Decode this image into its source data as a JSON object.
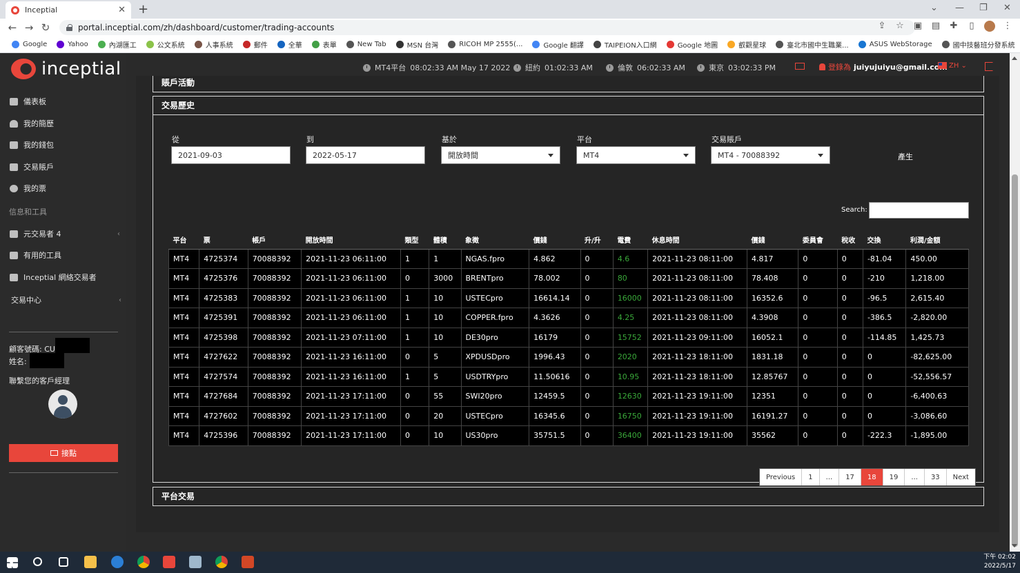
{
  "browser": {
    "tab_title": "Inceptial",
    "url": "portal.inceptial.com/zh/dashboard/customer/trading-accounts",
    "bookmarks": [
      "Google",
      "Yahoo",
      "內湖匯工",
      "公文系統",
      "人事系統",
      "郵件",
      "全華",
      "表單",
      "New Tab",
      "MSN 台灣",
      "RICOH MP 2555(...",
      "Google 翻譯",
      "TAIPEION入口網",
      "Google 地圖",
      "叡觀星球",
      "臺北市國中生職業...",
      "ASUS WebStorage",
      "國中技藝班分發系統"
    ]
  },
  "brand": {
    "name": "inceptial",
    "accent": "#e8463b"
  },
  "sidebar": {
    "items": [
      {
        "label": "儀表板",
        "icon": "home-icon"
      },
      {
        "label": "我的簡歷",
        "icon": "user-icon"
      },
      {
        "label": "我的錢包",
        "icon": "folder-icon"
      },
      {
        "label": "交易賬戶",
        "icon": "briefcase-icon"
      },
      {
        "label": "我的票",
        "icon": "chat-icon"
      }
    ],
    "section_label": "信息和工具",
    "tools": [
      {
        "label": "元交易者 4",
        "icon": "monitor-icon"
      },
      {
        "label": "有用的工具",
        "icon": "tools-icon"
      },
      {
        "label": "Inceptial 網絡交易者",
        "icon": "web-trader-icon"
      }
    ],
    "trading_center": "交易中心",
    "customer_no_label": "顧客號碼: CU",
    "name_label": "姓名: ",
    "contact_manager": "聯繫您的客戶經理",
    "contact_button": "接點"
  },
  "topbar": {
    "clocks": [
      {
        "label": "MT4平台",
        "time": "08:02:33 AM  May 17 2022"
      },
      {
        "label": "紐約",
        "time": "01:02:33 AM"
      },
      {
        "label": "倫敦",
        "time": "06:02:33 AM"
      },
      {
        "label": "東京",
        "time": "03:02:33 PM"
      }
    ],
    "login_label": "登錄為",
    "email": "juiyujuiyu@gmail.com",
    "lang": "ZH"
  },
  "panels": {
    "account_activity": "賬戶活動",
    "trade_history": "交易歷史",
    "platform_trades": "平台交易"
  },
  "filters": {
    "from_label": "從",
    "from_value": "2021-09-03",
    "to_label": "到",
    "to_value": "2022-05-17",
    "based_on_label": "基於",
    "based_on_value": "開放時間",
    "platform_label": "平台",
    "platform_value": "MT4",
    "account_label": "交易賬戶",
    "account_value": "MT4 - 70088392",
    "generate": "產生",
    "search_label": "Search:"
  },
  "table": {
    "headers": [
      "平台",
      "票",
      "帳戶",
      "開放時間",
      "類型",
      "體積",
      "象徵",
      "價錢",
      "升/升",
      "電費",
      "休息時間",
      "價錢",
      "委員會",
      "稅收",
      "交換",
      "利潤/金額"
    ],
    "rows": [
      [
        "MT4",
        "4725374",
        "70088392",
        "2021-11-23 06:11:00",
        "1",
        "1",
        "NGAS.fpro",
        "4.862",
        "0",
        "4.6",
        "2021-11-23 08:11:00",
        "4.817",
        "0",
        "0",
        "-81.04",
        "450.00"
      ],
      [
        "MT4",
        "4725376",
        "70088392",
        "2021-11-23 06:11:00",
        "0",
        "3000",
        "BRENTpro",
        "78.002",
        "0",
        "80",
        "2021-11-23 08:11:00",
        "78.408",
        "0",
        "0",
        "-210",
        "1,218.00"
      ],
      [
        "MT4",
        "4725383",
        "70088392",
        "2021-11-23 06:11:00",
        "1",
        "10",
        "USTECpro",
        "16614.14",
        "0",
        "16000",
        "2021-11-23 08:11:00",
        "16352.6",
        "0",
        "0",
        "-96.5",
        "2,615.40"
      ],
      [
        "MT4",
        "4725391",
        "70088392",
        "2021-11-23 06:11:00",
        "1",
        "10",
        "COPPER.fpro",
        "4.3626",
        "0",
        "4.25",
        "2021-11-23 08:11:00",
        "4.3908",
        "0",
        "0",
        "-386.5",
        "-2,820.00"
      ],
      [
        "MT4",
        "4725398",
        "70088392",
        "2021-11-23 07:11:00",
        "1",
        "10",
        "DE30pro",
        "16179",
        "0",
        "15752",
        "2021-11-23 09:11:00",
        "16052.1",
        "0",
        "0",
        "-114.85",
        "1,425.73"
      ],
      [
        "MT4",
        "4727622",
        "70088392",
        "2021-11-23 16:11:00",
        "0",
        "5",
        "XPDUSDpro",
        "1996.43",
        "0",
        "2020",
        "2021-11-23 18:11:00",
        "1831.18",
        "0",
        "0",
        "0",
        "-82,625.00"
      ],
      [
        "MT4",
        "4727574",
        "70088392",
        "2021-11-23 16:11:00",
        "1",
        "5",
        "USDTRYpro",
        "11.50616",
        "0",
        "10.95",
        "2021-11-23 18:11:00",
        "12.85767",
        "0",
        "0",
        "0",
        "-52,556.57"
      ],
      [
        "MT4",
        "4727684",
        "70088392",
        "2021-11-23 17:11:00",
        "0",
        "55",
        "SWI20pro",
        "12459.5",
        "0",
        "12630",
        "2021-11-23 19:11:00",
        "12351",
        "0",
        "0",
        "0",
        "-6,400.63"
      ],
      [
        "MT4",
        "4727602",
        "70088392",
        "2021-11-23 17:11:00",
        "0",
        "20",
        "USTECpro",
        "16345.6",
        "0",
        "16750",
        "2021-11-23 19:11:00",
        "16191.27",
        "0",
        "0",
        "0",
        "-3,086.60"
      ],
      [
        "MT4",
        "4725396",
        "70088392",
        "2021-11-23 17:11:00",
        "0",
        "10",
        "US30pro",
        "35751.5",
        "0",
        "36400",
        "2021-11-23 19:11:00",
        "35562",
        "0",
        "0",
        "-222.3",
        "-1,895.00"
      ]
    ]
  },
  "pagination": [
    "Previous",
    "1",
    "...",
    "17",
    "18",
    "19",
    "...",
    "33",
    "Next"
  ],
  "pagination_active": "18",
  "taskbar": {
    "time": "下午 02:02",
    "date": "2022/5/17"
  }
}
